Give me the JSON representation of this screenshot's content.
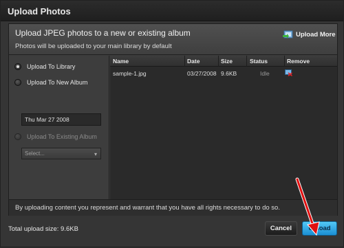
{
  "window": {
    "title": "Upload Photos"
  },
  "header": {
    "title": "Upload JPEG photos to a new or existing album",
    "subtitle": "Photos will be uploaded to your main library by default",
    "upload_more_label": "Upload More"
  },
  "options": {
    "library_label": "Upload To Library",
    "new_album_label": "Upload To New Album",
    "new_album_name": "Thu Mar 27 2008",
    "existing_album_label": "Upload To Existing Album",
    "existing_album_select": "Select...",
    "selected": "library"
  },
  "table": {
    "columns": [
      "Name",
      "Date",
      "Size",
      "Status",
      "Remove"
    ],
    "rows": [
      {
        "name": "sample-1.jpg",
        "date": "03/27/2008",
        "size": "9.6KB",
        "status": "Idle"
      }
    ]
  },
  "terms": "By uploading content you represent and warrant that you have all rights necessary to do so.",
  "footer": {
    "total": "Total upload size: 9.6KB",
    "cancel_label": "Cancel",
    "upload_label": "Upload"
  },
  "colors": {
    "accent": "#1b8fd4",
    "annotation_arrow": "#e01010"
  }
}
